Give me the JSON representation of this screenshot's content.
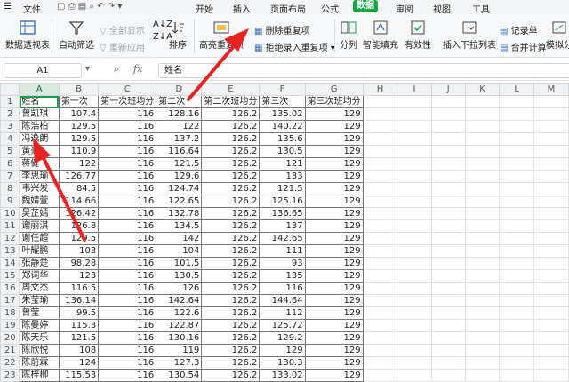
{
  "menu": {
    "file": "文件",
    "tabs": [
      "开始",
      "插入",
      "页面布局",
      "公式",
      "数据",
      "审阅",
      "视图",
      "工具"
    ],
    "active_tab": "数据"
  },
  "ribbon": {
    "pivot_table": "数据透视表",
    "auto_filter": "自动筛选",
    "show_all": "全部显示",
    "reapply": "重新应用",
    "sort": "排序",
    "highlight_duplicates": "高亮重复项",
    "remove_duplicates": "删除重复项",
    "reject_duplicates": "拒绝录入重复项",
    "split_column": "分列",
    "smart_fill": "智能填充",
    "validity": "有效性",
    "insert_dropdown": "插入下拉列表",
    "record_sheet": "记录单",
    "consolidate": "合并计算",
    "simulate": "模拟分"
  },
  "formula_bar": {
    "cell_ref": "A1",
    "fx": "fx",
    "content": "姓名"
  },
  "sheet": {
    "columns": [
      "A",
      "B",
      "C",
      "D",
      "E",
      "F",
      "G",
      "H",
      "I",
      "J",
      "K",
      "L",
      "M"
    ],
    "rows": [
      [
        "姓名",
        "第一次",
        "第一次班均分",
        "第二次",
        "第二次班均分",
        "第三次",
        "第三次班均分"
      ],
      [
        "曾凯琪",
        "107.4",
        "116",
        "128.16",
        "126.2",
        "135.02",
        "129"
      ],
      [
        "陈浩柏",
        "129.5",
        "116",
        "122",
        "126.2",
        "140.22",
        "129"
      ],
      [
        "冯逸朗",
        "129.5",
        "116",
        "137.2",
        "126.2",
        "135.6",
        "129"
      ],
      [
        "黄豪",
        "110.9",
        "116",
        "116.64",
        "126.2",
        "130.5",
        "129"
      ],
      [
        "蒋健",
        "122",
        "116",
        "121.5",
        "126.2",
        "121",
        "129"
      ],
      [
        "李思瑜",
        "126.77",
        "116",
        "129.6",
        "126.2",
        "133",
        "129"
      ],
      [
        "韦兴发",
        "84.5",
        "116",
        "124.74",
        "126.2",
        "121.5",
        "129"
      ],
      [
        "魏婧萱",
        "114.66",
        "116",
        "122.65",
        "126.2",
        "125.16",
        "129"
      ],
      [
        "吴芷嫣",
        "126.42",
        "116",
        "132.78",
        "126.2",
        "136.65",
        "129"
      ],
      [
        "谢丽淇",
        "126.8",
        "116",
        "134.5",
        "126.2",
        "137",
        "129"
      ],
      [
        "谢任超",
        "129.5",
        "116",
        "142",
        "126.2",
        "142.65",
        "129"
      ],
      [
        "叶耀鹏",
        "103",
        "116",
        "104",
        "126.2",
        "111",
        "129"
      ],
      [
        "张静楚",
        "98.28",
        "116",
        "101.5",
        "126.2",
        "93",
        "129"
      ],
      [
        "郑词华",
        "123",
        "116",
        "130.5",
        "126.2",
        "135",
        "129"
      ],
      [
        "周文杰",
        "116.5",
        "116",
        "126",
        "126.2",
        "116",
        "129"
      ],
      [
        "朱莹瑜",
        "136.14",
        "116",
        "142.64",
        "126.2",
        "144.64",
        "129"
      ],
      [
        "曾莹",
        "99.5",
        "116",
        "122.6",
        "126.2",
        "112",
        "129"
      ],
      [
        "陈曼婷",
        "115.3",
        "116",
        "122.87",
        "126.2",
        "125.72",
        "129"
      ],
      [
        "陈天乐",
        "121.5",
        "116",
        "130.16",
        "126.2",
        "129.2",
        "129"
      ],
      [
        "陈欣悦",
        "108",
        "116",
        "119",
        "126.2",
        "129",
        "129"
      ],
      [
        "陈前霖",
        "124",
        "116",
        "127.3",
        "126.2",
        "130.3",
        "129"
      ],
      [
        "陈梓柳",
        "115.53",
        "116",
        "130.54",
        "126.2",
        "133.02",
        "129"
      ]
    ]
  },
  "colors": {
    "accent": "#16a34a",
    "arrow": "#e8231f",
    "selection": "#1d9b45"
  }
}
